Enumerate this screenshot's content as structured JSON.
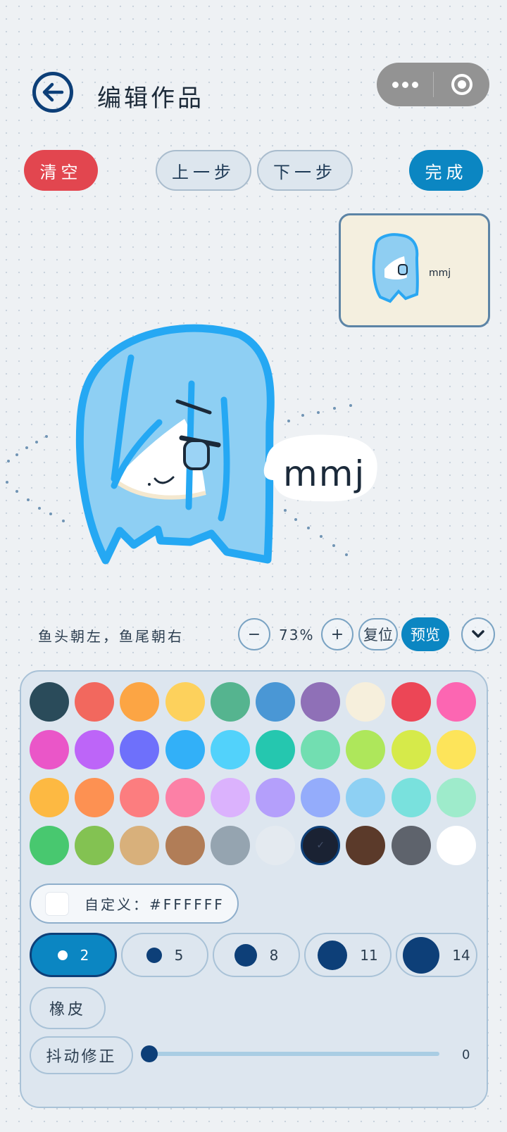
{
  "header": {
    "title": "编辑作品",
    "back_icon": "arrow-left-icon",
    "more_icon": "more-dots-icon",
    "close_icon": "target-circle-icon"
  },
  "toolbar": {
    "clear_label": "清空",
    "undo_label": "上一步",
    "redo_label": "下一步",
    "done_label": "完成"
  },
  "canvas": {
    "caption_text": "mmj"
  },
  "controls": {
    "hint": "鱼头朝左，鱼尾朝右",
    "zoom_out": "−",
    "zoom_value": "73%",
    "zoom_in": "+",
    "reset_label": "复位",
    "preview_label": "预览",
    "collapse_icon": "chevron-down-icon"
  },
  "palette": {
    "colors": [
      "#2a4b5a",
      "#f2685e",
      "#fca544",
      "#fdd15c",
      "#55b48f",
      "#4a97d5",
      "#8f70b7",
      "#f6efdc",
      "#ec4656",
      "#fc66b2",
      "#ea56c8",
      "#bd65f8",
      "#6e70fb",
      "#32b0f8",
      "#52d2fb",
      "#25c7af",
      "#72deb1",
      "#aee75b",
      "#d6ea4a",
      "#fde45a",
      "#fdb942",
      "#fd9152",
      "#fc7d7f",
      "#fc80a6",
      "#dbb2fd",
      "#b49ffb",
      "#94acfb",
      "#8ed0f3",
      "#79e1dd",
      "#9eebcb",
      "#48c86f",
      "#83c252",
      "#d8b07b",
      "#b17d57",
      "#95a4b0",
      "#e4eaf0",
      "#1a2233",
      "#5b3a2a",
      "#5e636c",
      "#ffffff"
    ],
    "selected_index": 36,
    "custom_label": "自定义：#FFFFFF",
    "custom_color": "#FFFFFF"
  },
  "brushes": {
    "sizes": [
      "2",
      "5",
      "8",
      "11",
      "14"
    ],
    "selected": "2"
  },
  "eraser_label": "橡皮",
  "stabilizer": {
    "label": "抖动修正",
    "value": "0"
  }
}
